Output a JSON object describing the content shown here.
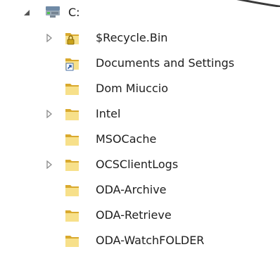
{
  "tree": {
    "root": {
      "label": "C:",
      "icon": "drive-icon",
      "expanded": true
    },
    "items": [
      {
        "label": "$Recycle.Bin",
        "icon": "locked-folder-icon",
        "expandable": true
      },
      {
        "label": "Documents and Settings",
        "icon": "shortcut-folder-icon",
        "expandable": false
      },
      {
        "label": "Dom Miuccio",
        "icon": "folder-icon",
        "expandable": false
      },
      {
        "label": "Intel",
        "icon": "folder-icon",
        "expandable": true
      },
      {
        "label": "MSOCache",
        "icon": "folder-icon",
        "expandable": false
      },
      {
        "label": "OCSClientLogs",
        "icon": "folder-icon",
        "expandable": true
      },
      {
        "label": "ODA-Archive",
        "icon": "folder-icon",
        "expandable": false
      },
      {
        "label": "ODA-Retrieve",
        "icon": "folder-icon",
        "expandable": false
      },
      {
        "label": "ODA-WatchFOLDER",
        "icon": "folder-icon",
        "expandable": false
      }
    ]
  },
  "colors": {
    "folder_light": "#f7e08a",
    "folder_dark": "#d9a92e",
    "arrow": "#8c8c8c",
    "text": "#1e1e1e"
  }
}
